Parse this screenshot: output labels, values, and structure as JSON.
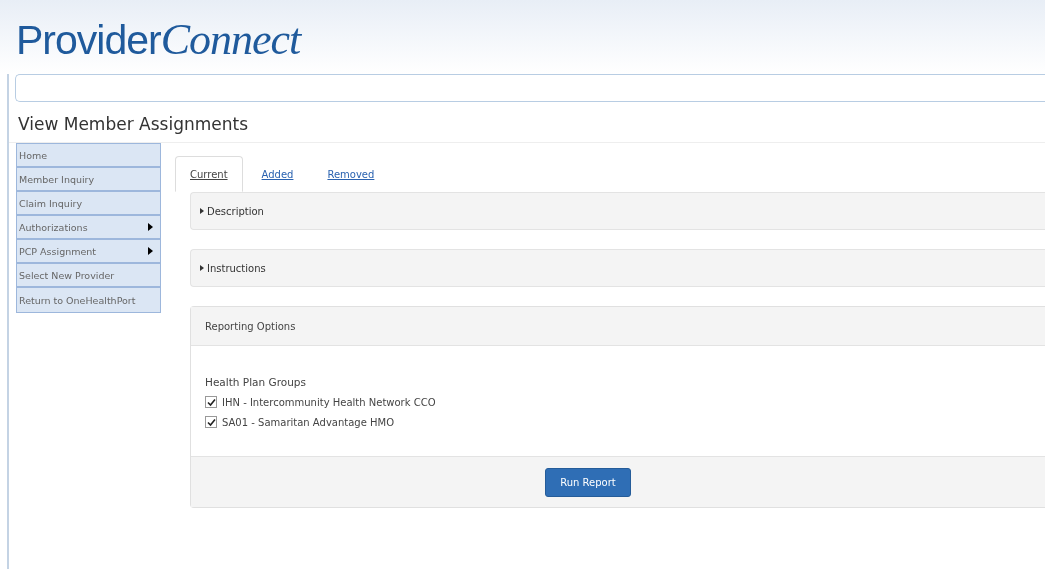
{
  "logo": {
    "plain": "Provider",
    "italic": "Connect"
  },
  "page_title": "View Member Assignments",
  "sidebar": {
    "items": [
      {
        "label": "Home",
        "submenu": false
      },
      {
        "label": "Member Inquiry",
        "submenu": false
      },
      {
        "label": "Claim Inquiry",
        "submenu": false
      },
      {
        "label": "Authorizations",
        "submenu": true
      },
      {
        "label": "PCP Assignment",
        "submenu": true
      },
      {
        "label": "Select New Provider",
        "submenu": false
      },
      {
        "label": "Return to OneHealthPort",
        "submenu": false
      }
    ]
  },
  "tabs": [
    {
      "label": "Current",
      "selected": true
    },
    {
      "label": "Added",
      "selected": false
    },
    {
      "label": "Removed",
      "selected": false
    }
  ],
  "sections": [
    {
      "title": "Description",
      "expanded": false
    },
    {
      "title": "Instructions",
      "expanded": false
    }
  ],
  "reporting": {
    "title": "Reporting Options",
    "group_label": "Health Plan Groups",
    "options": [
      {
        "label": "IHN - Intercommunity Health Network CCO",
        "checked": true
      },
      {
        "label": "SA01 - Samaritan Advantage HMO",
        "checked": true
      }
    ],
    "button": "Run Report"
  }
}
